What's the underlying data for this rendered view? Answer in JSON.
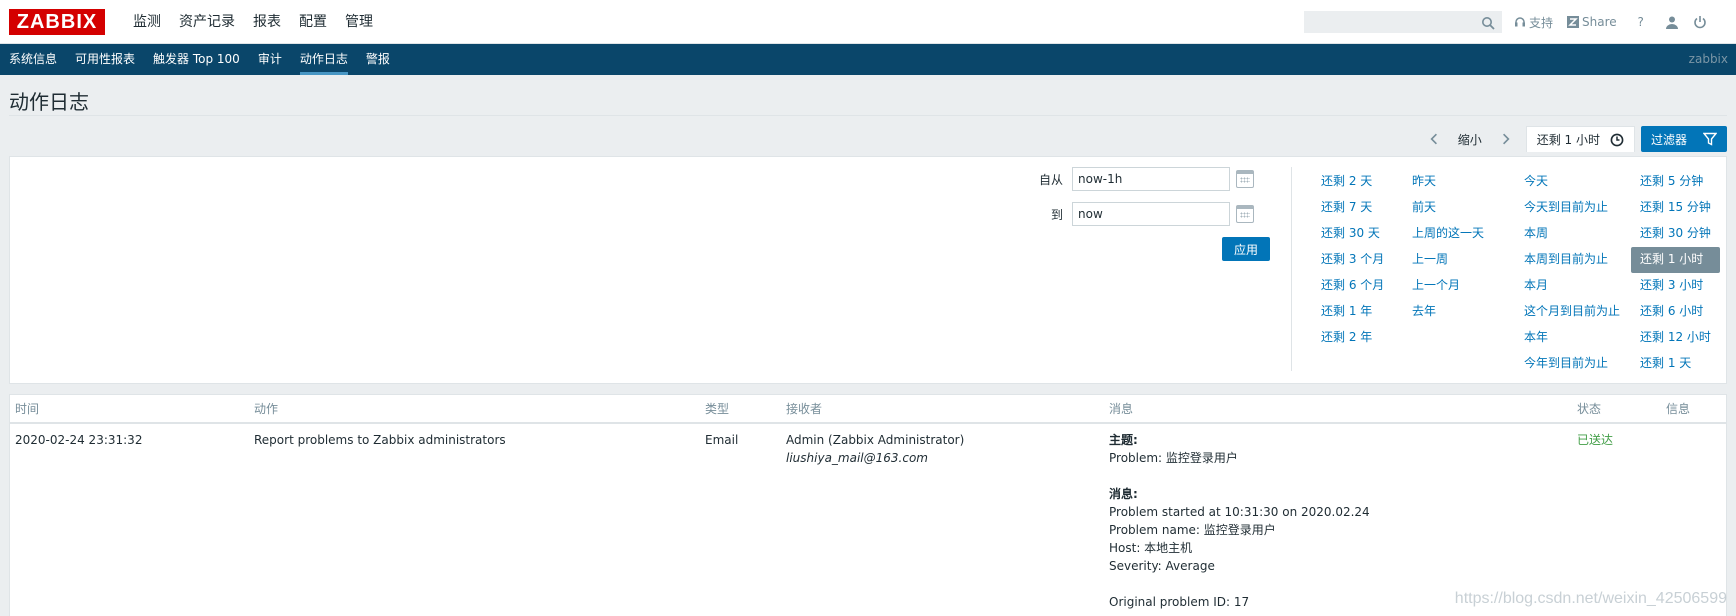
{
  "header": {
    "logo": "ZABBIX",
    "nav": [
      "监测",
      "资产记录",
      "报表",
      "配置",
      "管理"
    ],
    "support": "支持",
    "share": "Share",
    "help": "?"
  },
  "subnav": {
    "items": [
      "系统信息",
      "可用性报表",
      "触发器 Top 100",
      "审计",
      "动作日志",
      "警报"
    ],
    "active": "动作日志",
    "user": "zabbix"
  },
  "page": {
    "title": "动作日志"
  },
  "timecontrol": {
    "zoom_out": "缩小",
    "current": "还剩 1 小时",
    "filter_label": "过滤器"
  },
  "filter": {
    "from_label": "自从",
    "from_value": "now-1h",
    "to_label": "到",
    "to_value": "now",
    "apply": "应用",
    "quick_col1": [
      "还剩 2 天",
      "还剩 7 天",
      "还剩 30 天",
      "还剩 3 个月",
      "还剩 6 个月",
      "还剩 1 年",
      "还剩 2 年"
    ],
    "quick_col2": [
      "昨天",
      "前天",
      "上周的这一天",
      "上一周",
      "上一个月",
      "去年"
    ],
    "quick_col3": [
      "今天",
      "今天到目前为止",
      "本周",
      "本周到目前为止",
      "本月",
      "这个月到目前为止",
      "本年",
      "今年到目前为止"
    ],
    "quick_col4": [
      "还剩 5 分钟",
      "还剩 15 分钟",
      "还剩 30 分钟",
      "还剩 1 小时",
      "还剩 3 小时",
      "还剩 6 小时",
      "还剩 12 小时",
      "还剩 1 天"
    ],
    "selected": "还剩 1 小时"
  },
  "table": {
    "headers": [
      "时间",
      "动作",
      "类型",
      "接收者",
      "消息",
      "状态",
      "信息"
    ],
    "row": {
      "time": "2020-02-24 23:31:32",
      "action": "Report problems to Zabbix administrators",
      "type": "Email",
      "recipient_name": "Admin (Zabbix Administrator)",
      "recipient_email": "liushiya_mail@163.com",
      "subject_label": "主题:",
      "subject": "Problem: 监控登录用户",
      "message_label": "消息:",
      "message_lines": [
        "Problem started at 10:31:30 on 2020.02.24",
        "Problem name: 监控登录用户",
        "Host: 本地主机",
        "Severity: Average",
        "",
        "Original problem ID: 17"
      ],
      "status": "已送达"
    }
  },
  "watermark": "https://blog.csdn.net/weixin_42506599"
}
